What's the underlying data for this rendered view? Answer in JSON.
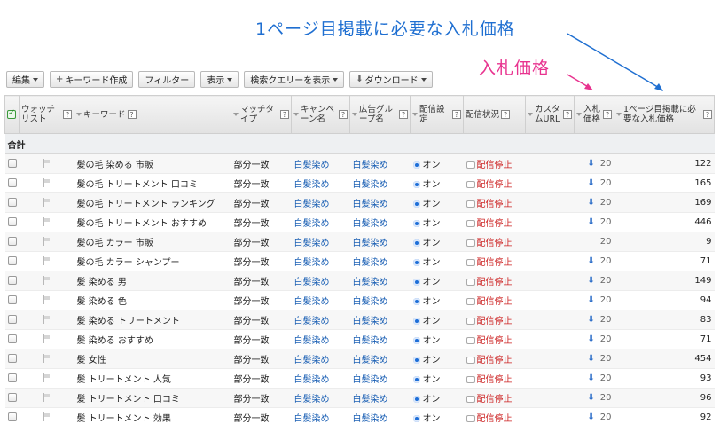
{
  "annotations": {
    "first_page_bid": "1ページ目掲載に必要な入札価格",
    "bid": "入札価格"
  },
  "toolbar": {
    "edit": "編集",
    "create_keyword": "キーワード作成",
    "filter": "フィルター",
    "view": "表示",
    "show_search_queries": "検索クエリーを表示",
    "download": "ダウンロード"
  },
  "columns": {
    "watchlist": "ウォッチリスト",
    "keyword": "キーワード",
    "match_type": "マッチタイプ",
    "campaign": "キャンペーン名",
    "ad_group": "広告グループ名",
    "delivery_setting": "配信設定",
    "delivery_status": "配信状況",
    "custom_url": "カスタムURL",
    "bid": "入札価格",
    "first_page_bid": "1ページ目掲載に必要な入札価格"
  },
  "total_label": "合計",
  "rows": [
    {
      "keyword": "髪の毛 染める 市販",
      "match": "部分一致",
      "campaign": "白髪染め",
      "adgroup": "白髪染め",
      "setting": "オン",
      "status": "配信停止",
      "bid": "20",
      "bid_icon": true,
      "first_page": "122"
    },
    {
      "keyword": "髪の毛 トリートメント 口コミ",
      "match": "部分一致",
      "campaign": "白髪染め",
      "adgroup": "白髪染め",
      "setting": "オン",
      "status": "配信停止",
      "bid": "20",
      "bid_icon": true,
      "first_page": "165"
    },
    {
      "keyword": "髪の毛 トリートメント ランキング",
      "match": "部分一致",
      "campaign": "白髪染め",
      "adgroup": "白髪染め",
      "setting": "オン",
      "status": "配信停止",
      "bid": "20",
      "bid_icon": true,
      "first_page": "169"
    },
    {
      "keyword": "髪の毛 トリートメント おすすめ",
      "match": "部分一致",
      "campaign": "白髪染め",
      "adgroup": "白髪染め",
      "setting": "オン",
      "status": "配信停止",
      "bid": "20",
      "bid_icon": true,
      "first_page": "446"
    },
    {
      "keyword": "髪の毛 カラー 市販",
      "match": "部分一致",
      "campaign": "白髪染め",
      "adgroup": "白髪染め",
      "setting": "オン",
      "status": "配信停止",
      "bid": "20",
      "bid_icon": false,
      "first_page": "9"
    },
    {
      "keyword": "髪の毛 カラー シャンプー",
      "match": "部分一致",
      "campaign": "白髪染め",
      "adgroup": "白髪染め",
      "setting": "オン",
      "status": "配信停止",
      "bid": "20",
      "bid_icon": true,
      "first_page": "71"
    },
    {
      "keyword": "髪 染める 男",
      "match": "部分一致",
      "campaign": "白髪染め",
      "adgroup": "白髪染め",
      "setting": "オン",
      "status": "配信停止",
      "bid": "20",
      "bid_icon": true,
      "first_page": "149"
    },
    {
      "keyword": "髪 染める 色",
      "match": "部分一致",
      "campaign": "白髪染め",
      "adgroup": "白髪染め",
      "setting": "オン",
      "status": "配信停止",
      "bid": "20",
      "bid_icon": true,
      "first_page": "94"
    },
    {
      "keyword": "髪 染める トリートメント",
      "match": "部分一致",
      "campaign": "白髪染め",
      "adgroup": "白髪染め",
      "setting": "オン",
      "status": "配信停止",
      "bid": "20",
      "bid_icon": true,
      "first_page": "83"
    },
    {
      "keyword": "髪 染める おすすめ",
      "match": "部分一致",
      "campaign": "白髪染め",
      "adgroup": "白髪染め",
      "setting": "オン",
      "status": "配信停止",
      "bid": "20",
      "bid_icon": true,
      "first_page": "71"
    },
    {
      "keyword": "髪 女性",
      "match": "部分一致",
      "campaign": "白髪染め",
      "adgroup": "白髪染め",
      "setting": "オン",
      "status": "配信停止",
      "bid": "20",
      "bid_icon": true,
      "first_page": "454"
    },
    {
      "keyword": "髪 トリートメント 人気",
      "match": "部分一致",
      "campaign": "白髪染め",
      "adgroup": "白髪染め",
      "setting": "オン",
      "status": "配信停止",
      "bid": "20",
      "bid_icon": true,
      "first_page": "93"
    },
    {
      "keyword": "髪 トリートメント 口コミ",
      "match": "部分一致",
      "campaign": "白髪染め",
      "adgroup": "白髪染め",
      "setting": "オン",
      "status": "配信停止",
      "bid": "20",
      "bid_icon": true,
      "first_page": "96"
    },
    {
      "keyword": "髪 トリートメント 効果",
      "match": "部分一致",
      "campaign": "白髪染め",
      "adgroup": "白髪染め",
      "setting": "オン",
      "status": "配信停止",
      "bid": "20",
      "bid_icon": true,
      "first_page": "92"
    }
  ]
}
